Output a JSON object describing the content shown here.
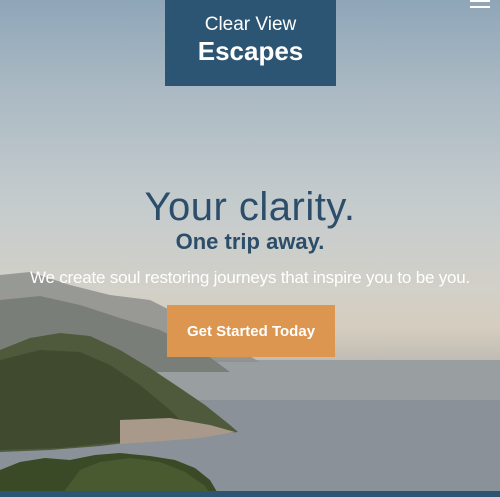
{
  "brand": {
    "line1": "Clear View",
    "line2": "Escapes",
    "color": "#2c5574"
  },
  "nav": {
    "menu_icon": "hamburger-menu-icon"
  },
  "hero": {
    "headline": "Your clarity.",
    "subheadline": "One trip away.",
    "tagline": "We create soul restoring journeys that inspire you to be you.",
    "cta_label": "Get Started Today",
    "cta_color": "#dd9650",
    "text_color": "#2c4e6b"
  }
}
